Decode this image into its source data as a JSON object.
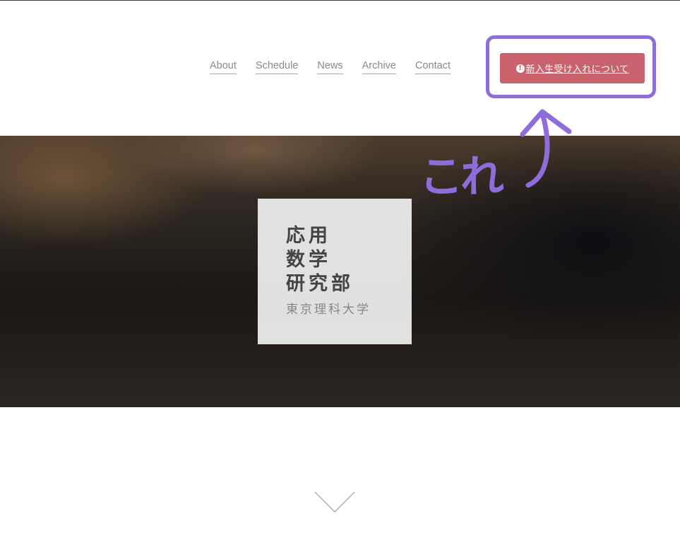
{
  "nav": {
    "items": [
      {
        "label": "About"
      },
      {
        "label": "Schedule"
      },
      {
        "label": "News"
      },
      {
        "label": "Archive"
      },
      {
        "label": "Contact"
      }
    ]
  },
  "cta": {
    "icon": "exclamation-circle-icon",
    "icon_glyph": "!",
    "label": "新入生受け入れについて",
    "color": "#c8636e"
  },
  "hero": {
    "title_lines": [
      "応用",
      "数学",
      "研究部"
    ],
    "subtitle": "東京理科大学"
  },
  "annotation": {
    "text": "これ",
    "color": "#8e6cdc"
  },
  "scroll_icon": "chevron-down-icon"
}
